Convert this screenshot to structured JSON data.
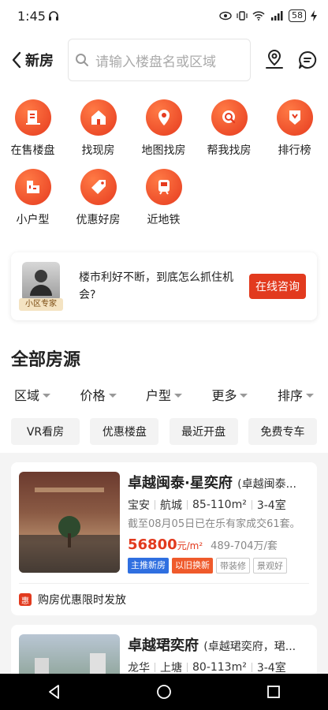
{
  "status_bar": {
    "time": "1:45",
    "battery": "58"
  },
  "header": {
    "back_label": "新房",
    "search_placeholder": "请输入楼盘名或区域"
  },
  "categories_row1": [
    {
      "label": "在售楼盘",
      "icon": "building-icon"
    },
    {
      "label": "找现房",
      "icon": "house-icon"
    },
    {
      "label": "地图找房",
      "icon": "map-pin-icon"
    },
    {
      "label": "帮我找房",
      "icon": "search-house-icon"
    },
    {
      "label": "排行榜",
      "icon": "ranking-badge-icon"
    }
  ],
  "categories_row2": [
    {
      "label": "小户型",
      "icon": "floorplan-icon"
    },
    {
      "label": "优惠好房",
      "icon": "discount-tag-icon"
    },
    {
      "label": "近地铁",
      "icon": "subway-icon"
    }
  ],
  "consult": {
    "tag": "小区专家",
    "text": "楼市利好不断，到底怎么抓住机会?",
    "button": "在线咨询"
  },
  "section": {
    "title": "全部房源",
    "filters": [
      "区域",
      "价格",
      "户型",
      "更多",
      "排序"
    ],
    "chips": [
      "VR看房",
      "优惠楼盘",
      "最近开盘",
      "免费专车"
    ]
  },
  "listings": [
    {
      "name": "卓越闽泰·星奕府",
      "alias": "(卓越闽泰...",
      "district": "宝安",
      "area": "航城",
      "size": "85-110m²",
      "rooms": "3-4室",
      "deal": "截至08月05日已在乐有家成交61套。",
      "price": "56800",
      "price_unit": "元/m²",
      "total": "489-704万/套",
      "tags": [
        "主推新房",
        "以旧换新",
        "带装修",
        "景观好"
      ],
      "promo": "购房优惠限时发放"
    },
    {
      "name": "卓越珺奕府",
      "alias": "(卓越珺奕府，珺...",
      "district": "龙华",
      "area": "上塘",
      "size": "80-113m²",
      "rooms": "3-4室"
    }
  ]
}
